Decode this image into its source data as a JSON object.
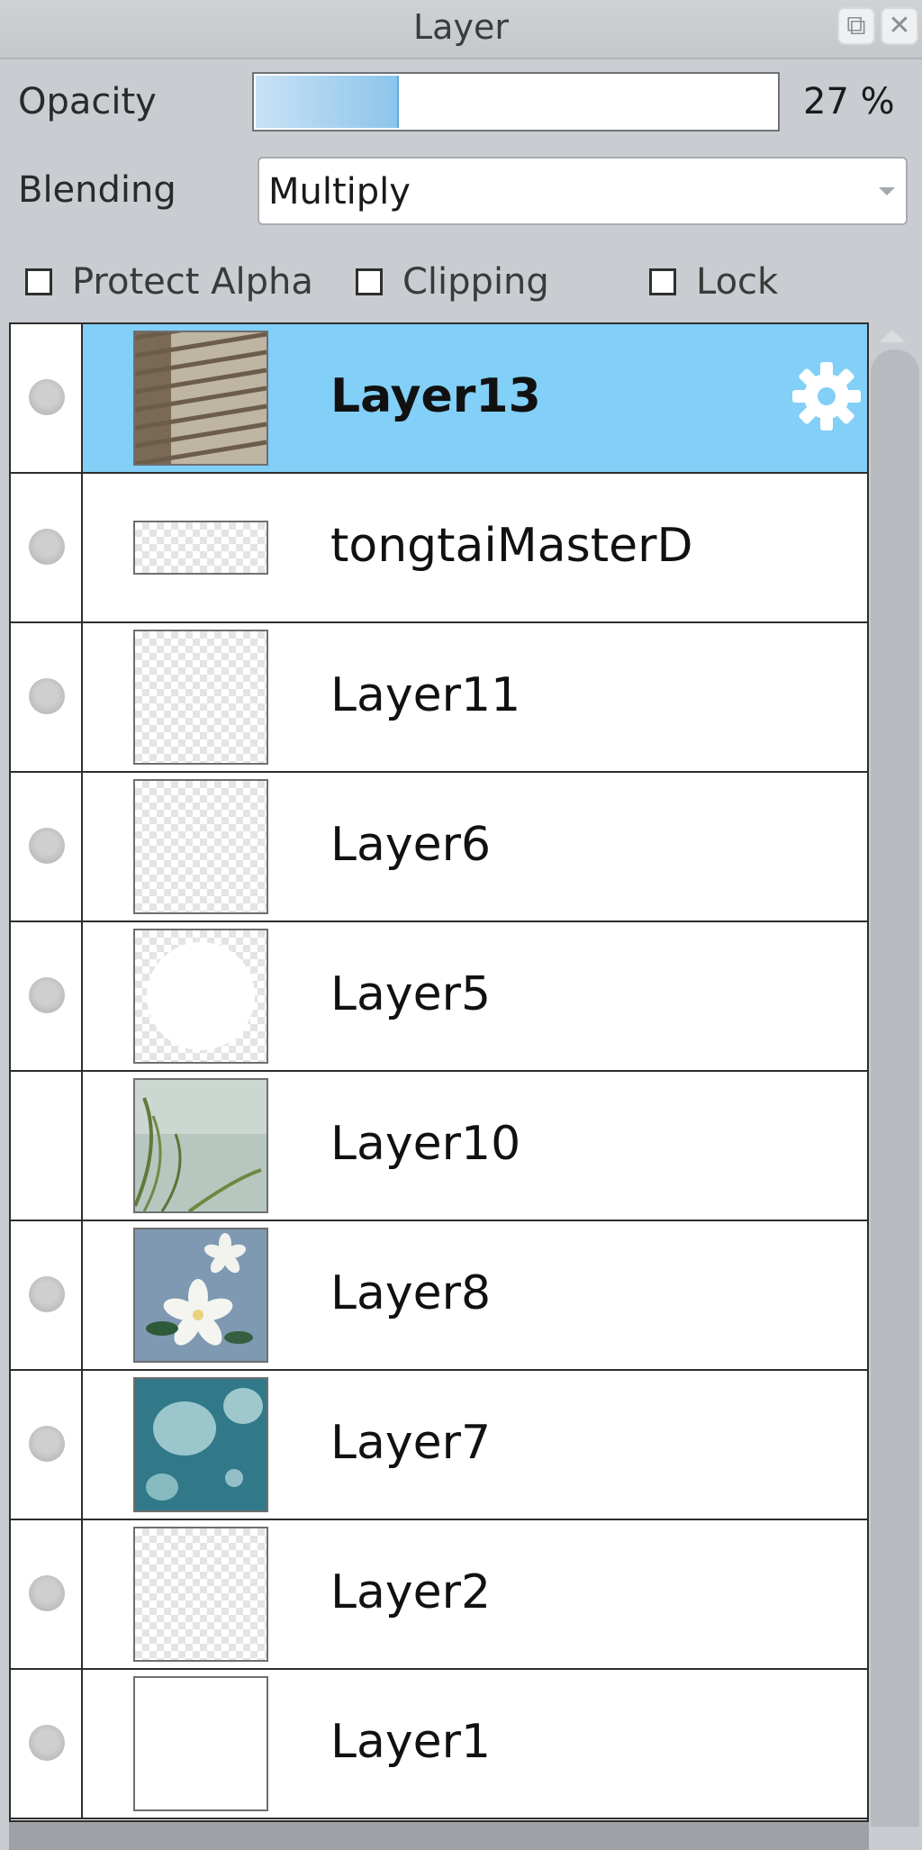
{
  "panel": {
    "title": "Layer"
  },
  "titlebar": {
    "detach_icon": "detach-window-icon",
    "close_icon": "close-icon"
  },
  "opacity": {
    "label": "Opacity",
    "value_text": "27 %",
    "fraction": 0.27
  },
  "blending": {
    "label": "Blending",
    "selected": "Multiply"
  },
  "options": {
    "protect_alpha": "Protect Alpha",
    "clipping": "Clipping",
    "lock": "Lock"
  },
  "layers": [
    {
      "name": "Layer13",
      "selected": true,
      "visible_dot": true,
      "thumb": "blinds"
    },
    {
      "name": "tongtaiMasterD",
      "selected": false,
      "visible_dot": true,
      "thumb": "checker-short"
    },
    {
      "name": "Layer11",
      "selected": false,
      "visible_dot": true,
      "thumb": "checker"
    },
    {
      "name": "Layer6",
      "selected": false,
      "visible_dot": true,
      "thumb": "checker"
    },
    {
      "name": "Layer5",
      "selected": false,
      "visible_dot": true,
      "thumb": "circle"
    },
    {
      "name": "Layer10",
      "selected": false,
      "visible_dot": false,
      "thumb": "grass"
    },
    {
      "name": "Layer8",
      "selected": false,
      "visible_dot": true,
      "thumb": "flowers"
    },
    {
      "name": "Layer7",
      "selected": false,
      "visible_dot": true,
      "thumb": "jellyfish"
    },
    {
      "name": "Layer2",
      "selected": false,
      "visible_dot": true,
      "thumb": "checker"
    },
    {
      "name": "Layer1",
      "selected": false,
      "visible_dot": true,
      "thumb": "white"
    }
  ],
  "colors": {
    "selection": "#82cff7",
    "opacity_fill": "#8cc5ec"
  }
}
